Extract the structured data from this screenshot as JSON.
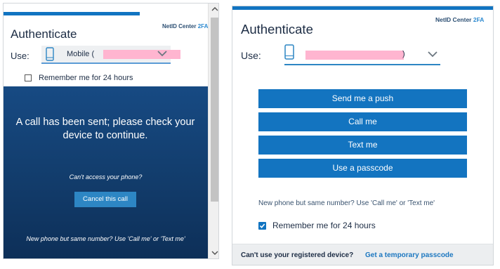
{
  "left": {
    "brand": {
      "name": "NetID Center",
      "suffix": "2FA"
    },
    "title": "Authenticate",
    "use_label": "Use:",
    "device": {
      "label_prefix": "Mobile (",
      "label_suffix": ")",
      "icon": "phone-icon"
    },
    "remember_label": "Remember me for 24 hours",
    "remember_checked": false,
    "status_message": "A call has been sent; please check your device to continue.",
    "cant_access": "Can't access your phone?",
    "cancel_button": "Cancel this call",
    "new_phone_hint": "New phone but same number? Use 'Call me' or 'Text me'"
  },
  "right": {
    "brand": {
      "name": "NetID Center",
      "suffix": "2FA"
    },
    "title": "Authenticate",
    "use_label": "Use:",
    "device": {
      "label_suffix": ")",
      "icon": "phone-icon"
    },
    "buttons": [
      "Send me a push",
      "Call me",
      "Text me",
      "Use a passcode"
    ],
    "new_phone_hint": "New phone but same number? Use 'Call me' or 'Text me'",
    "remember_label": "Remember me for 24 hours",
    "remember_checked": true,
    "footer": {
      "question": "Can't use your registered device?",
      "link": "Get a temporary passcode"
    }
  },
  "colors": {
    "accent": "#1374c0",
    "dark_panel": "#123c6b",
    "redaction": "#ffb5d0"
  }
}
